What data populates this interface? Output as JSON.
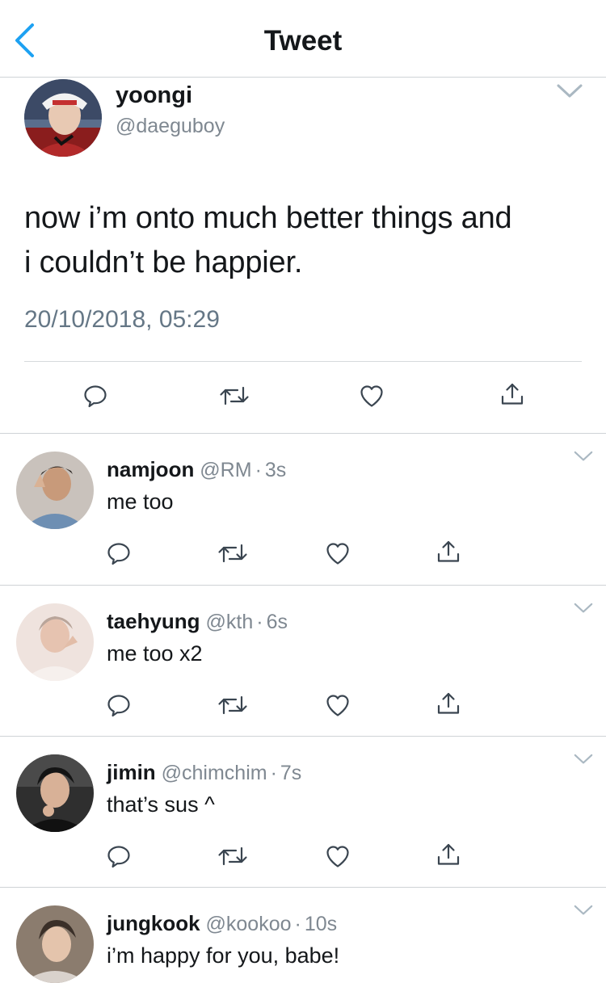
{
  "nav": {
    "title": "Tweet"
  },
  "tweet": {
    "name": "yoongi",
    "handle": "@daeguboy",
    "text_line1": "now i’m onto much better things and",
    "text_line2": "i couldn’t be happier.",
    "timestamp": "20/10/2018, 05:29"
  },
  "replies": [
    {
      "name": "namjoon",
      "handle": "@RM",
      "time": "3s",
      "text": "me too"
    },
    {
      "name": "taehyung",
      "handle": "@kth",
      "time": "6s",
      "text": "me too x2"
    },
    {
      "name": "jimin",
      "handle": "@chimchim",
      "time": "7s",
      "text": "that’s sus ^"
    },
    {
      "name": "jungkook",
      "handle": "@kookoo",
      "time": "10s",
      "text": "i’m happy for you, babe!"
    }
  ],
  "separator": "·",
  "colors": {
    "accent": "#1da1f2",
    "icon": "#657786",
    "text": "#14171a",
    "secondary": "#657786",
    "divider": "#cfd3d6"
  },
  "icons": [
    "chevron-left-icon",
    "chevron-down-icon",
    "reply-icon",
    "retweet-icon",
    "like-icon",
    "share-icon"
  ]
}
